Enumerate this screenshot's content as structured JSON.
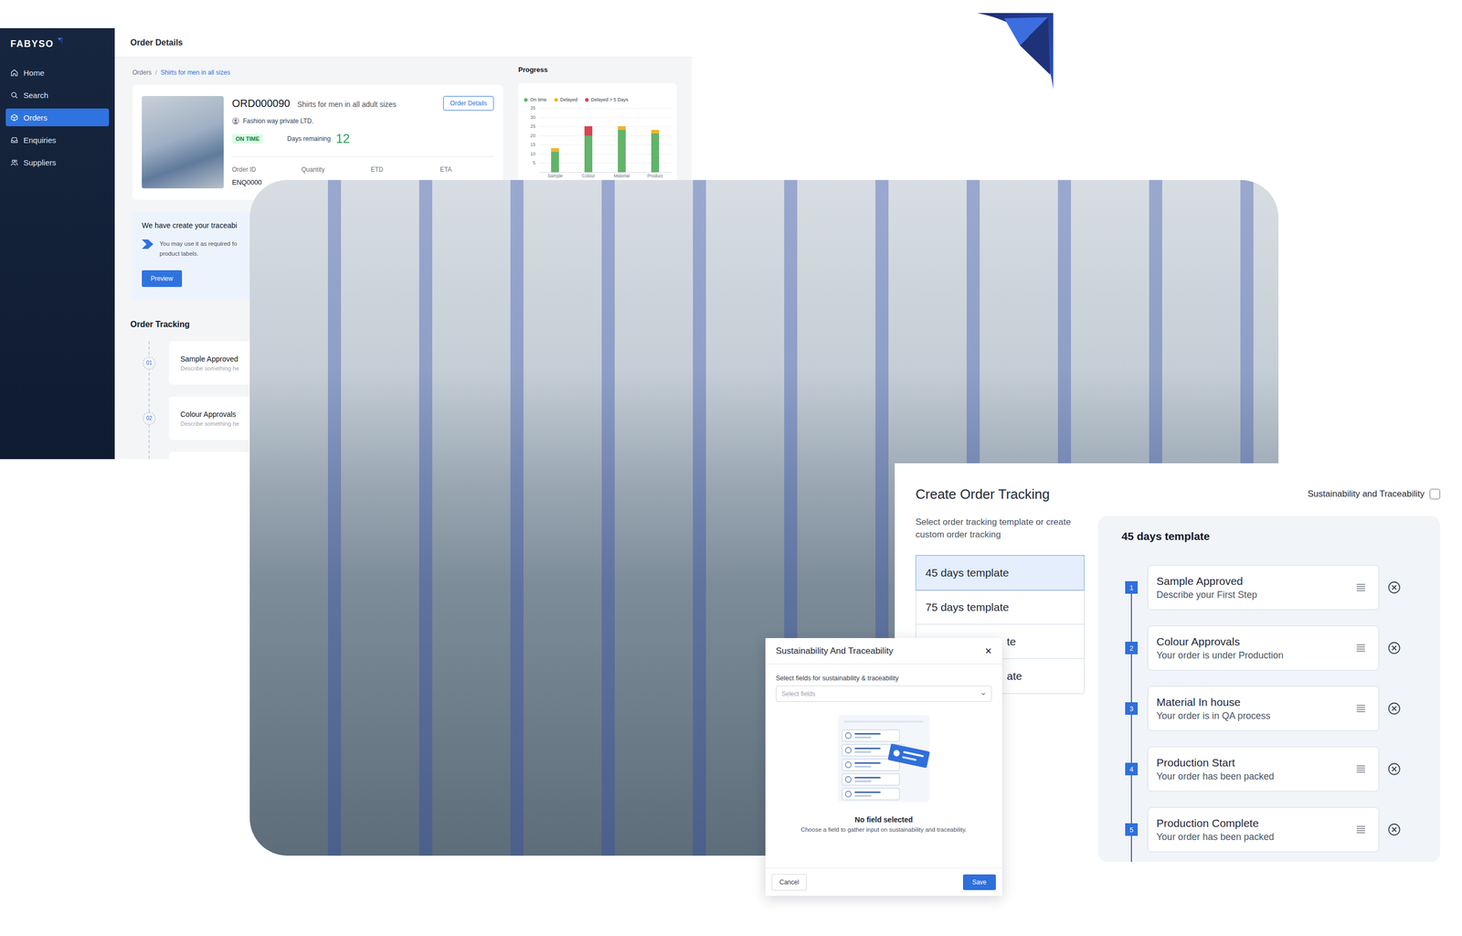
{
  "app": {
    "logo": "FABYSO",
    "sidebar": [
      {
        "label": "Home",
        "selected": false
      },
      {
        "label": "Search",
        "selected": false
      },
      {
        "label": "Orders",
        "selected": true
      },
      {
        "label": "Enquiries",
        "selected": false
      },
      {
        "label": "Suppliers",
        "selected": false
      }
    ],
    "header": "Order Details",
    "breadcrumb": [
      "Orders",
      "/",
      "Shirts for men in all sizes"
    ],
    "order": {
      "id": "ORD000090",
      "title": "Shirts for men in all adult sizes",
      "button": "Order Details",
      "supplier": "Fashion way private LTD.",
      "status": "ON TIME",
      "days_label": "Days remaining",
      "days": "12",
      "columns": [
        "Order ID",
        "Quantity",
        "ETD",
        "ETA"
      ],
      "values": [
        "ENQ0000"
      ]
    },
    "traceability": {
      "title": "We have create your traceabi",
      "lines": [
        "You may use it as required fo",
        "product labels."
      ],
      "button": "Preview"
    },
    "tracking": {
      "title": "Order Tracking",
      "steps": [
        {
          "number": "01",
          "title": "Sample Approved",
          "desc": "Describe something he"
        },
        {
          "number": "02",
          "title": "Colour Approvals",
          "desc": "Describe something he"
        }
      ]
    },
    "progress": {
      "title": "Progress",
      "ticks": [
        "35",
        "30",
        "25",
        "20",
        "15",
        "10",
        "5"
      ],
      "categories": [
        "Sample",
        "Colour",
        "Material",
        "Product"
      ],
      "series": [
        {
          "label": "On time",
          "color": "#62b46a",
          "values": [
            11,
            20,
            23,
            21
          ]
        },
        {
          "label": "Delayed",
          "color": "#f0b429",
          "values": [
            2,
            0,
            2,
            2
          ]
        },
        {
          "label": "Delayed > 5 Days",
          "color": "#d64550",
          "values": [
            0,
            5,
            0,
            0
          ]
        }
      ]
    }
  },
  "create": {
    "title": "Create Order Tracking",
    "sustainability": {
      "label": "Sustainability and Traceability",
      "checked": false
    },
    "subtitle": "Select order tracking template or create custom order tracking",
    "templates": [
      {
        "label": "45 days template",
        "selected": true
      },
      {
        "label": "75 days template",
        "selected": false
      },
      {
        "label": "te",
        "selected": false
      },
      {
        "label": "ate",
        "selected": false
      }
    ],
    "panel_title": "45 days template",
    "steps": [
      {
        "number": "1",
        "title": "Sample Approved",
        "desc": "Describe your First Step"
      },
      {
        "number": "2",
        "title": "Colour Approvals",
        "desc": "Your order is under Production"
      },
      {
        "number": "3",
        "title": "Material In house",
        "desc": "Your order is in QA process"
      },
      {
        "number": "4",
        "title": "Production Start",
        "desc": "Your order has been packed"
      },
      {
        "number": "5",
        "title": "Production Complete",
        "desc": "Your order has been packed"
      }
    ]
  },
  "modal": {
    "title": "Sustainability And Traceability",
    "close": "×",
    "field_label": "Select fields for sustainability & traceability",
    "placeholder": "Select fields",
    "empty_title": "No field selected",
    "empty_desc": "Choose a field to gather input on sustainability and traceability.",
    "buttons": [
      {
        "label": "Cancel",
        "kind": "secondary"
      },
      {
        "label": "Save",
        "kind": "primary"
      }
    ]
  }
}
